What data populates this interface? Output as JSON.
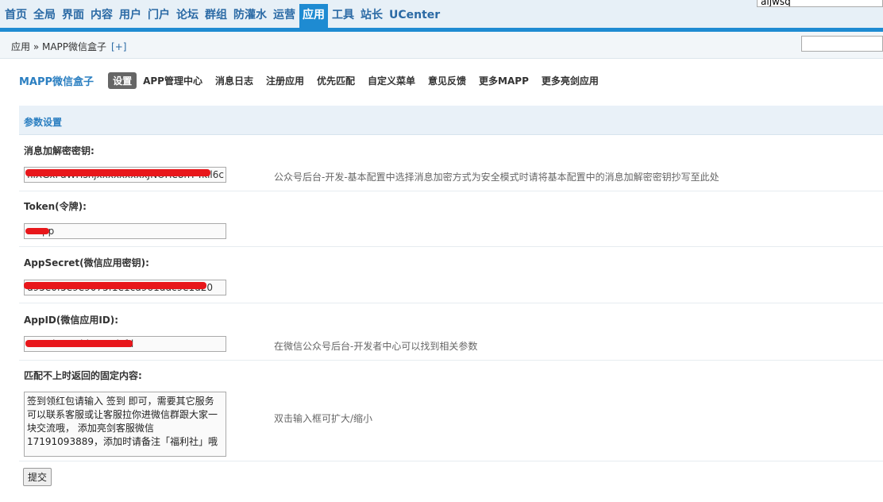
{
  "nav": {
    "tabs": [
      "首页",
      "全局",
      "界面",
      "内容",
      "用户",
      "门户",
      "论坛",
      "群组",
      "防灌水",
      "运营",
      "应用",
      "工具",
      "站长",
      "UCenter"
    ],
    "active_index": 10,
    "search_value": "aljwsq"
  },
  "breadcrumb": {
    "text": "应用 » MAPP微信盒子",
    "add_label": "[+]"
  },
  "app": {
    "title": "MAPP微信盒子",
    "menu": [
      "设置",
      "APP管理中心",
      "消息日志",
      "注册应用",
      "优先匹配",
      "自定义菜单",
      "意见反馈",
      "更多MAPP",
      "更多亮剑应用"
    ],
    "active_menu_index": 0
  },
  "section": {
    "title": "参数设置"
  },
  "fields": {
    "aes_key": {
      "label": "消息加解密密钥:",
      "value": "filXGxPaWHsnjxxxxxxxxxJNOHe8hT4kll6c",
      "hint": "公众号后台-开发-基本配置中选择消息加密方式为安全模式时请将基本配置中的消息加解密密钥抄写至此处"
    },
    "token": {
      "label": "Token(令牌):",
      "value": "mapp"
    },
    "app_secret": {
      "label": "AppSecret(微信应用密钥):",
      "value": "d95e0f5e9e9075f1e1cd961ddc9e1d20"
    },
    "app_id": {
      "label": "AppID(微信应用ID):",
      "value": "wx12b995dd54e5dcfd",
      "hint": "在微信公众号后台-开发者中心可以找到相关参数"
    },
    "fallback": {
      "label": "匹配不上时返回的固定内容:",
      "value": "签到领红包请输入 签到 即可，需要其它服务可以联系客服或让客服拉你进微信群跟大家一块交流哦， 添加亮剑客服微信17191093889，添加时请备注「福利社」哦",
      "hint": "双击输入框可扩大/缩小"
    }
  },
  "submit_label": "提交"
}
